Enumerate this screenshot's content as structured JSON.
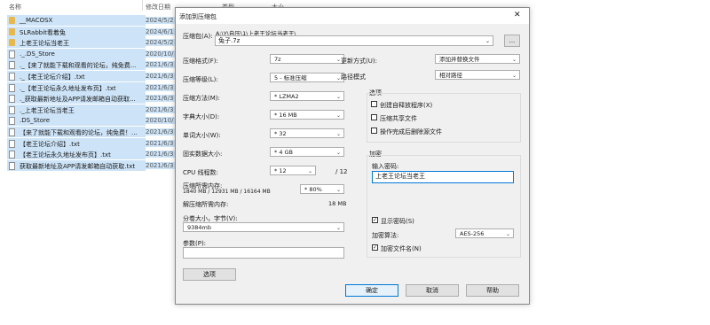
{
  "explorer": {
    "columns": {
      "name": "名称",
      "modified": "修改日期",
      "type": "类型",
      "size": "大小"
    },
    "rows": [
      {
        "name": "__MACOSX",
        "date": "2024/5/2",
        "icon": "folder-icon"
      },
      {
        "name": "SLRabbit看着兔",
        "date": "2024/6/1",
        "icon": "folder-icon"
      },
      {
        "name": "上老王论坛当老王",
        "date": "2024/5/2",
        "icon": "folder-icon"
      },
      {
        "name": "._.DS_Store",
        "date": "2020/10/",
        "icon": "file-icon"
      },
      {
        "name": "._【来了就能下载和观看的论坛，纯免费...",
        "date": "2021/6/3",
        "icon": "file-icon"
      },
      {
        "name": "._【老王论坛介绍】.txt",
        "date": "2021/6/3",
        "icon": "file-icon"
      },
      {
        "name": "._【老王论坛永久地址发布页】.txt",
        "date": "2021/6/3",
        "icon": "file-icon"
      },
      {
        "name": "._获取最新地址及APP请发邮箱自动获取...",
        "date": "2021/6/3",
        "icon": "file-icon"
      },
      {
        "name": "._上老王论坛当老王",
        "date": "2021/6/3",
        "icon": "file-icon"
      },
      {
        "name": ".DS_Store",
        "date": "2020/10/",
        "icon": "file-icon"
      },
      {
        "name": "【来了就能下载和观看的论坛，纯免费！...",
        "date": "2021/6/3",
        "icon": "file-icon"
      },
      {
        "name": "【老王论坛介绍】.txt",
        "date": "2021/6/3",
        "icon": "file-icon"
      },
      {
        "name": "【老王论坛永久地址发布页】.txt",
        "date": "2021/6/3",
        "icon": "file-icon"
      },
      {
        "name": "获取最新地址及APP请发邮箱自动获取.txt",
        "date": "2021/6/3",
        "icon": "file-icon"
      }
    ]
  },
  "dialog": {
    "title": "添加到压缩包",
    "close": "✕",
    "archive_label": "压缩包(A):",
    "archive_path": "A:\\Y\\自压\\1\\上老王论坛当老王\\",
    "archive_name": "兔子.7z",
    "browse": "...",
    "format_label": "压缩格式(F):",
    "format_value": "7z",
    "level_label": "压缩等级(L):",
    "level_value": "5 - 标准压缩",
    "method_label": "压缩方法(M):",
    "method_value": "* LZMA2",
    "dict_label": "字典大小(D):",
    "dict_value": "* 16 MB",
    "word_label": "单词大小(W):",
    "word_value": "* 32",
    "solid_label": "固实数据大小:",
    "solid_value": "* 4 GB",
    "threads_label": "CPU 线程数:",
    "threads_value": "* 12",
    "threads_max": "/ 12",
    "mem_comp_label": "压缩所需内存:",
    "mem_comp_detail": "1840 MB / 12931 MB / 16164 MB",
    "mem_comp_value": "* 80%",
    "mem_decomp_label": "解压缩所需内存:",
    "mem_decomp_value": "18 MB",
    "split_label": "分卷大小，字节(V):",
    "split_value": "9384mb",
    "params_label": "参数(P):",
    "params_value": "",
    "options_button": "选项",
    "update_label": "更新方式(U):",
    "update_value": "添加并替换文件",
    "pathmode_label": "路径模式",
    "pathmode_value": "相对路径",
    "options_group": "选项",
    "opt_sfx": "创建自释放程序(X)",
    "opt_shared": "压缩共享文件",
    "opt_delete": "操作完成后删除源文件",
    "enc_group": "加密",
    "password_label": "输入密码:",
    "password_value": "上老王论坛当老王",
    "show_password": "显示密码(S)",
    "enc_method_label": "加密算法:",
    "enc_method_value": "AES-256",
    "encrypt_names": "加密文件名(N)",
    "ok": "确定",
    "cancel": "取消",
    "help": "帮助"
  }
}
